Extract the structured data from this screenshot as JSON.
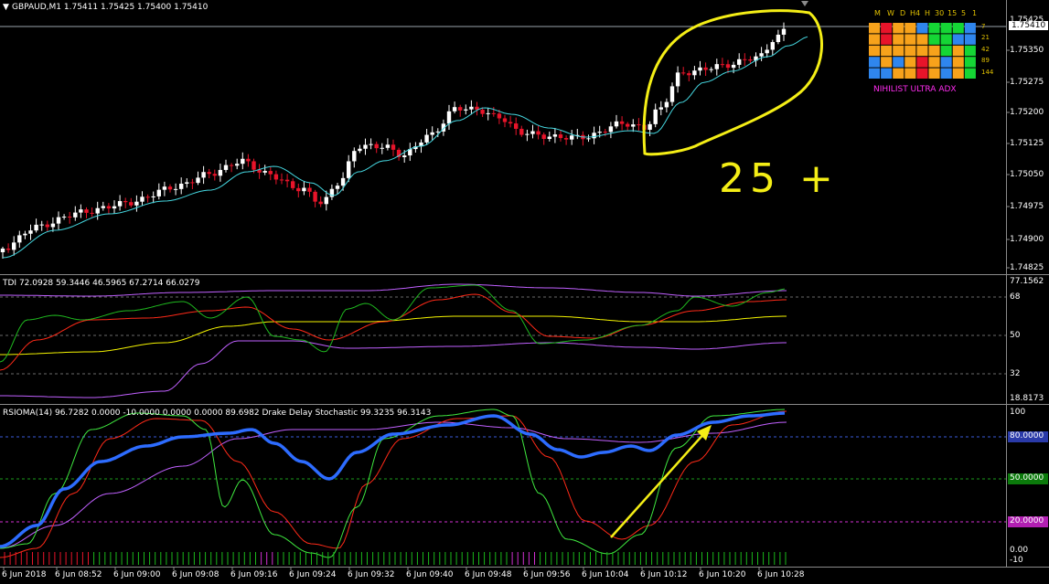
{
  "header": {
    "symbol_line": "GBPAUD,M1  1.75411 1.75425 1.75400 1.75410",
    "menu_icon": "triangle-down-icon"
  },
  "price_axis": {
    "current": "1.75410",
    "labels": [
      "1.75350",
      "1.75275",
      "1.75200",
      "1.75125",
      "1.75050",
      "1.74975",
      "1.74900",
      "1.74825"
    ],
    "top_label": "1.75425"
  },
  "tdi": {
    "title": "TDI 72.0928 59.3446 46.5965 67.2714 66.0279",
    "axis": [
      "77.1562",
      "68",
      "50",
      "32",
      "18.8173"
    ]
  },
  "rsioma": {
    "title": "RSIOMA(14) 96.7282 0.0000 -10.0000 0.0000 0.0000 89.6982  Drake Delay Stochastic 99.3235 96.3143",
    "axis": [
      "100",
      "80.0000",
      "50.0000",
      "20.0000",
      "0.00",
      "-10"
    ]
  },
  "time_axis": [
    "6 Jun 2018",
    "6 Jun 08:52",
    "6 Jun 09:00",
    "6 Jun 09:08",
    "6 Jun 09:16",
    "6 Jun 09:24",
    "6 Jun 09:32",
    "6 Jun 09:40",
    "6 Jun 09:48",
    "6 Jun 09:56",
    "6 Jun 10:04",
    "6 Jun 10:12",
    "6 Jun 10:20",
    "6 Jun 10:28"
  ],
  "adx_panel": {
    "title": "NIHILIST ULTRA ADX",
    "timeframes": [
      "M",
      "W",
      "D",
      "H4",
      "H",
      "30",
      "15",
      "5",
      "1"
    ],
    "periods": [
      "7",
      "21",
      "42",
      "89",
      "144"
    ],
    "colors": {
      "orange": "#f7a21b",
      "red": "#e8142a",
      "blue": "#2f86ee",
      "green": "#15d635"
    }
  },
  "annotation": {
    "text": "25 +",
    "color": "#f4ee16"
  },
  "colors": {
    "bull_candle": "#ffffff",
    "bear_candle": "#e8142a",
    "ma": "#45d7e0",
    "tdi_green": "#1fb91f",
    "tdi_red": "#ff2a18",
    "tdi_yellow": "#f4f400",
    "tdi_violet": "#c060ff",
    "rsi_blue": "#2d6cff",
    "stoch_green": "#3fe83f",
    "stoch_red": "#ff2a18"
  }
}
